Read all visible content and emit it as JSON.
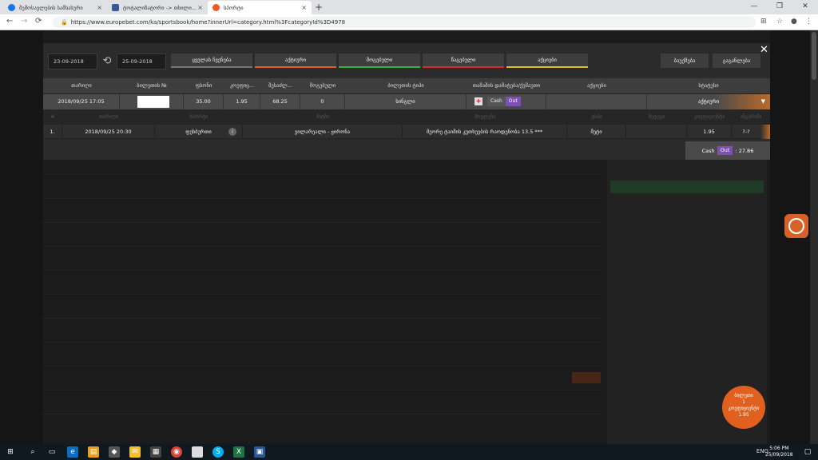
{
  "browser": {
    "tabs": [
      {
        "title": "შემოსავლების სამსახური"
      },
      {
        "title": "ტოტალიზატორი -> თხილი..."
      },
      {
        "title": "სპორტი"
      }
    ],
    "url": "https://www.europebet.com/ka/sportsbook/home?innerUrl=category.html%3FcategoryId%3D4978"
  },
  "filters": {
    "date_from": "23-09-2018",
    "date_to": "25-09-2018",
    "buttons": [
      {
        "label": "ყველას ჩვენება",
        "color": "#777777"
      },
      {
        "label": "აქტიური",
        "color": "#e2601f"
      },
      {
        "label": "მოგებული",
        "color": "#3cb043"
      },
      {
        "label": "წაგებული",
        "color": "#d32f2f"
      },
      {
        "label": "აქციები",
        "color": "#e0c020"
      }
    ],
    "right_buttons": [
      "ბაუქმება",
      "გაგანლება"
    ]
  },
  "table": {
    "headers": [
      "თარიღი",
      "ბილეთის №",
      "ფსონი",
      "კოეფიც...",
      "შესაძლ...",
      "მოგებული",
      "ბილეთის ტიპი",
      "თამაშის დამატება/ქეშაუთი",
      "აქციები",
      "სტატუსი"
    ],
    "row": {
      "date": "2018/09/25 17:05",
      "stake": "35.00",
      "odds": "1.95",
      "possible": "68.25",
      "won": "0",
      "type": "სინგლი",
      "cash_label": "Cash",
      "out_label": "Out",
      "status": "აქტიური"
    }
  },
  "detail": {
    "headers": [
      "#",
      "თარიღი",
      "სპორტი",
      "მატჩი",
      "მოვლენა",
      "ტიპი",
      "შედეგი",
      "კოეფიციენტი",
      "ანგარიში"
    ],
    "row": {
      "index": "1.",
      "date": "2018/09/25 20:30",
      "sport": "ფეხბურთი",
      "match": "ვილარეალი - ჟირონა",
      "event": "მეორე ტაიმის კუთხეების რაოდენობა 13.5 ***",
      "type": "მეტი",
      "odds": "1.95",
      "score": "?-?"
    }
  },
  "cashout_total": {
    "cash": "Cash",
    "out": "Out",
    "value": ": 27.86"
  },
  "bet_bubble": {
    "line1": "ბილეთი",
    "count": "1",
    "line2": "კოეფიციენტი",
    "odds": "1.95"
  },
  "taskbar": {
    "time": "5:06 PM",
    "date": "25/09/2018",
    "lang": "ENG"
  }
}
